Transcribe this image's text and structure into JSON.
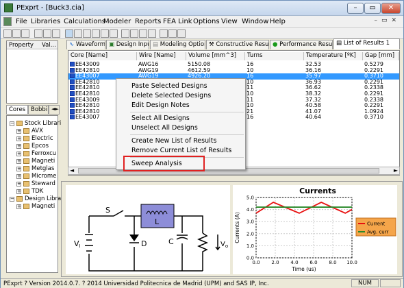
{
  "titlebar": {
    "title": "PExprt - [Buck3.cia]",
    "min": "–",
    "max": "▭",
    "close": "✕"
  },
  "menu": [
    "File",
    "Libraries",
    "Calculations",
    "Modeler",
    "Reports",
    "FEA Link",
    "Options",
    "View",
    "Window",
    "Help"
  ],
  "left": {
    "props_headers": [
      "Property",
      "Val..."
    ],
    "tabs": [
      "Cores",
      "Bobbi",
      "◄►"
    ],
    "tree": [
      {
        "label": "Stock Librari",
        "level": 0,
        "box": "−"
      },
      {
        "label": "AVX",
        "level": 1,
        "box": "+"
      },
      {
        "label": "Electric",
        "level": 1,
        "box": "+"
      },
      {
        "label": "Epcos",
        "level": 1,
        "box": "+"
      },
      {
        "label": "Ferroxcu",
        "level": 1,
        "box": "+"
      },
      {
        "label": "Magneti",
        "level": 1,
        "box": "+"
      },
      {
        "label": "Metglas",
        "level": 1,
        "box": "+"
      },
      {
        "label": "Microme",
        "level": 1,
        "box": "+"
      },
      {
        "label": "Steward",
        "level": 1,
        "box": "+"
      },
      {
        "label": "TDK",
        "level": 1,
        "box": "+"
      },
      {
        "label": "Design Librar",
        "level": 0,
        "box": "−"
      },
      {
        "label": "Magneti",
        "level": 1,
        "box": "+"
      }
    ]
  },
  "tabs": [
    {
      "label": "Waveforms",
      "icon": "waveform-icon"
    },
    {
      "label": "Design Inputs",
      "icon": "design-inputs-icon"
    },
    {
      "label": "Modeling Options",
      "icon": "modeling-icon"
    },
    {
      "label": "Constructive Results",
      "icon": "wrench-icon"
    },
    {
      "label": "Performance Results",
      "icon": "check-icon"
    },
    {
      "label": "List of Results 1",
      "icon": "list-icon"
    }
  ],
  "table": {
    "headers": [
      "Core [Name]",
      "Wire [Name]",
      "Volume [mm^3]",
      "Turns",
      "Temperature [ºK]",
      "Gap [mm]"
    ],
    "rows": [
      [
        "EE43009",
        "AWG16",
        "5150.08",
        "16",
        "32.53",
        "0.5279"
      ],
      [
        "EE42810",
        "AWG19",
        "4612.59",
        "10",
        "36.16",
        "0.2291"
      ],
      [
        "EE43007",
        "AWG19",
        "4926.20",
        "16",
        "35.97",
        "0.3710"
      ],
      [
        "EE42810",
        "",
        "",
        "10",
        "36.93",
        "0.2291"
      ],
      [
        "EE42810",
        "",
        "",
        "11",
        "36.62",
        "0.2338"
      ],
      [
        "EE42810",
        "",
        "",
        "10",
        "38.32",
        "0.2291"
      ],
      [
        "EE43009",
        "",
        "",
        "11",
        "37.32",
        "0.2338"
      ],
      [
        "EE42810",
        "",
        "",
        "10",
        "40.58",
        "0.2291"
      ],
      [
        "EE42810",
        "",
        "",
        "21",
        "41.07",
        "1.0924"
      ],
      [
        "EE43007",
        "",
        "",
        "16",
        "40.64",
        "0.3710"
      ]
    ]
  },
  "context_menu": {
    "items": [
      "Paste Selected Designs",
      "Delete Selected Designs",
      "Edit Design Notes",
      "Select All Designs",
      "Unselect All Designs",
      "Create New List of Results",
      "Remove Current List of Results",
      "Sweep Analysis"
    ]
  },
  "circuit": {
    "labels": [
      "S",
      "L",
      "V",
      "I",
      "D",
      "C",
      "V",
      "o"
    ]
  },
  "chart_data": {
    "type": "line",
    "title": "Currents",
    "xlabel": "Time (us)",
    "ylabel": "Currents (A)",
    "xlim": [
      0,
      10
    ],
    "ylim": [
      0,
      5
    ],
    "xticks": [
      "0.0",
      "2.0",
      "4.0",
      "6.0",
      "8.0",
      "10.0"
    ],
    "yticks": [
      "0.0",
      "1.0",
      "2.0",
      "3.0",
      "4.0",
      "5.0"
    ],
    "grid": true,
    "legend": "right",
    "series": [
      {
        "name": "Current",
        "color": "#e81010",
        "x": [
          0,
          1.8,
          4.5,
          6.8,
          9.3,
          10
        ],
        "y": [
          3.7,
          4.6,
          3.7,
          4.6,
          3.7,
          4.0
        ]
      },
      {
        "name": "Avg. curr",
        "color": "#2a8a2a",
        "x": [
          0,
          10
        ],
        "y": [
          4.2,
          4.2
        ]
      }
    ]
  },
  "status": {
    "text": "PExprt ? Version 2014.0.7. ? 2014 Universidad Politecnica de Madrid (UPM) and SAS IP, Inc.",
    "num": "NUM"
  }
}
